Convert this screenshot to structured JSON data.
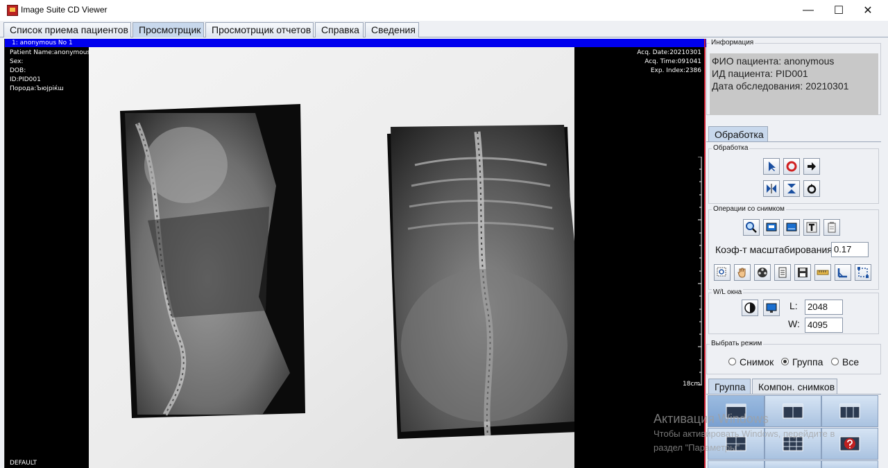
{
  "window": {
    "title": "Image Suite CD Viewer",
    "minimize": "—",
    "maximize": "☐",
    "close": "✕"
  },
  "tabs": [
    {
      "label": "Список приема пациентов"
    },
    {
      "label": "Просмотрщик"
    },
    {
      "label": "Просмотрщик отчетов"
    },
    {
      "label": "Справка"
    },
    {
      "label": "Сведения"
    }
  ],
  "active_tab": "Просмотрщик",
  "viewer": {
    "header": "1: anonymous  No 1",
    "left_info": [
      "Patient Name:anonymous",
      "Sex:",
      "DOB:",
      "ID:PID001",
      "Порода:Ъюјріќш"
    ],
    "right_info": [
      "Acq. Date:20210301",
      "Acq. Time:091041",
      "Exp. Index:2386"
    ],
    "scale_label": "18cm",
    "preset": "DEFAULT"
  },
  "info": {
    "legend": "Информация",
    "lines": [
      "ФИО пациента: anonymous",
      "ИД пациента: PID001",
      "Дата обследования: 20210301"
    ]
  },
  "processing": {
    "tab": "Обработка",
    "group_legend": "Обработка",
    "ops_legend": "Операции со снимком",
    "zoom_label": "Коэф-т масштабирования",
    "zoom_value": "0.17",
    "wl_legend": "W/L окна",
    "l_label": "L:",
    "l_value": "2048",
    "w_label": "W:",
    "w_value": "4095"
  },
  "mode": {
    "legend": "Выбрать режим",
    "options": [
      "Снимок",
      "Группа",
      "Все"
    ],
    "selected": "Группа"
  },
  "bottom_tabs": [
    "Группа",
    "Компон. снимков"
  ],
  "watermark": {
    "title": "Активация Windows",
    "line1": "Чтобы активировать Windows, перейдите в",
    "line2": "раздел \"Параметры\"."
  },
  "colors": {
    "viewer_header": "#0000ee",
    "info_bg": "#c8c8c8",
    "active_tab": "#c8d8ec"
  }
}
